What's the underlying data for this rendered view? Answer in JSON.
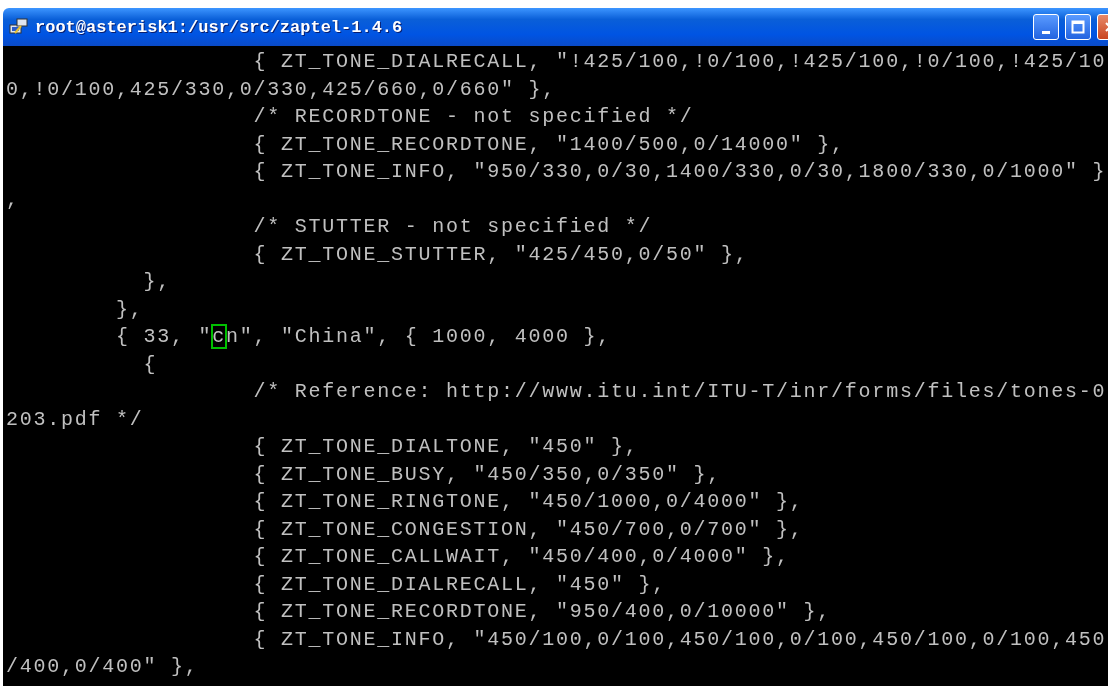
{
  "window": {
    "title": "root@asterisk1:/usr/src/zaptel-1.4.6"
  },
  "terminal": {
    "lines": [
      {
        "kind": "plain",
        "text": "                  { ZT_TONE_DIALRECALL, \"!425/100,!0/100,!425/100,!0/100,!425/10"
      },
      {
        "kind": "plain",
        "text": "0,!0/100,425/330,0/330,425/660,0/660\" },"
      },
      {
        "kind": "plain",
        "text": "                  /* RECORDTONE - not specified */"
      },
      {
        "kind": "plain",
        "text": "                  { ZT_TONE_RECORDTONE, \"1400/500,0/14000\" },"
      },
      {
        "kind": "plain",
        "text": "                  { ZT_TONE_INFO, \"950/330,0/30,1400/330,0/30,1800/330,0/1000\" }"
      },
      {
        "kind": "plain",
        "text": ","
      },
      {
        "kind": "plain",
        "text": "                  /* STUTTER - not specified */"
      },
      {
        "kind": "plain",
        "text": "                  { ZT_TONE_STUTTER, \"425/450,0/50\" },"
      },
      {
        "kind": "plain",
        "text": "          },"
      },
      {
        "kind": "plain",
        "text": "        },"
      },
      {
        "kind": "cursor",
        "before": "        { 33, \"",
        "cursor": "c",
        "after": "n\", \"China\", { 1000, 4000 },"
      },
      {
        "kind": "plain",
        "text": "          {"
      },
      {
        "kind": "plain",
        "text": "                  /* Reference: http://www.itu.int/ITU-T/inr/forms/files/tones-0"
      },
      {
        "kind": "plain",
        "text": "203.pdf */"
      },
      {
        "kind": "plain",
        "text": "                  { ZT_TONE_DIALTONE, \"450\" },"
      },
      {
        "kind": "plain",
        "text": "                  { ZT_TONE_BUSY, \"450/350,0/350\" },"
      },
      {
        "kind": "plain",
        "text": "                  { ZT_TONE_RINGTONE, \"450/1000,0/4000\" },"
      },
      {
        "kind": "plain",
        "text": "                  { ZT_TONE_CONGESTION, \"450/700,0/700\" },"
      },
      {
        "kind": "plain",
        "text": "                  { ZT_TONE_CALLWAIT, \"450/400,0/4000\" },"
      },
      {
        "kind": "plain",
        "text": "                  { ZT_TONE_DIALRECALL, \"450\" },"
      },
      {
        "kind": "plain",
        "text": "                  { ZT_TONE_RECORDTONE, \"950/400,0/10000\" },"
      },
      {
        "kind": "plain",
        "text": "                  { ZT_TONE_INFO, \"450/100,0/100,450/100,0/100,450/100,0/100,450"
      },
      {
        "kind": "plain",
        "text": "/400,0/400\" },"
      }
    ]
  }
}
